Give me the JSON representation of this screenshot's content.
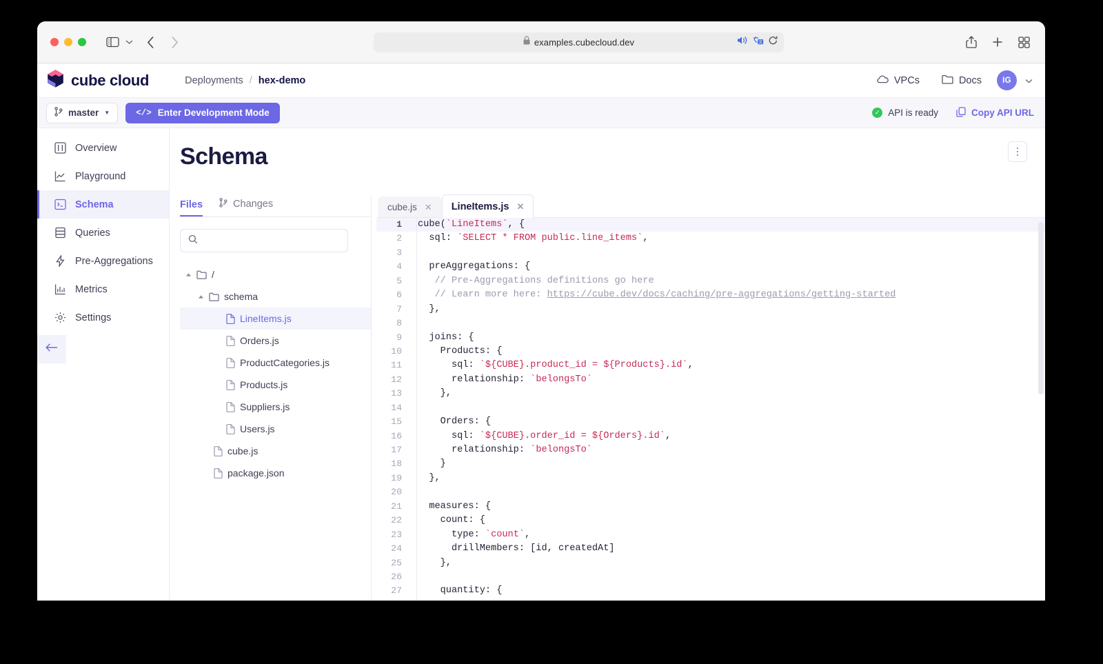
{
  "browser": {
    "url": "examples.cubecloud.dev",
    "lock_icon": "lock-icon",
    "traffic_lights": [
      "close",
      "minimize",
      "maximize"
    ],
    "icons": {
      "sidebar_toggle": "sidebar-toggle-icon",
      "sidebar_chevron": "chevron-down-icon",
      "back": "chevron-left-icon",
      "forward": "chevron-right-icon",
      "audio": "speaker-icon",
      "translate": "translate-icon",
      "reload": "reload-icon",
      "share": "share-icon",
      "new_tab": "plus-icon",
      "tab_overview": "tab-grid-icon"
    }
  },
  "topnav": {
    "logo_text": "cube cloud",
    "breadcrumb": {
      "root": "Deployments",
      "separator": "/",
      "current": "hex-demo"
    },
    "links": [
      {
        "label": "VPCs",
        "icon": "cloud-icon"
      },
      {
        "label": "Docs",
        "icon": "folder-icon"
      }
    ],
    "avatar_initials": "IG",
    "avatar_color": "#7a77eb"
  },
  "action_bar": {
    "branch": "master",
    "branch_icon": "git-branch-icon",
    "branch_chevron": "▼",
    "dev_mode_label": "Enter Development Mode",
    "dev_mode_glyph": "</>",
    "dev_mode_color": "#6c67e5",
    "api_status": "API is ready",
    "api_status_color": "#34c759",
    "copy_api_label": "Copy API URL",
    "copy_api_icon": "copy-icon"
  },
  "sidebar": {
    "items": [
      {
        "label": "Overview",
        "icon": "layout-icon",
        "active": false
      },
      {
        "label": "Playground",
        "icon": "chart-line-icon",
        "active": false
      },
      {
        "label": "Schema",
        "icon": "terminal-icon",
        "active": true
      },
      {
        "label": "Queries",
        "icon": "database-icon",
        "active": false
      },
      {
        "label": "Pre-Aggregations",
        "icon": "lightning-icon",
        "active": false
      },
      {
        "label": "Metrics",
        "icon": "bar-chart-icon",
        "active": false
      },
      {
        "label": "Settings",
        "icon": "gear-icon",
        "active": false
      }
    ],
    "collapse_icon": "arrow-left-icon"
  },
  "main": {
    "page_title": "Schema",
    "menu_icon": "kebab-vertical-icon"
  },
  "files_panel": {
    "tabs": [
      {
        "label": "Files",
        "icon": null,
        "active": true
      },
      {
        "label": "Changes",
        "icon": "git-branch-icon",
        "active": false
      }
    ],
    "search_placeholder": "",
    "search_value": "",
    "search_icon": "search-icon",
    "tree": [
      {
        "depth": 0,
        "type": "folder",
        "label": "/",
        "expanded": true,
        "selected": false
      },
      {
        "depth": 1,
        "type": "folder",
        "label": "schema",
        "expanded": true,
        "selected": false
      },
      {
        "depth": 2,
        "type": "file",
        "label": "LineItems.js",
        "selected": true
      },
      {
        "depth": 2,
        "type": "file",
        "label": "Orders.js",
        "selected": false
      },
      {
        "depth": 2,
        "type": "file",
        "label": "ProductCategories.js",
        "selected": false
      },
      {
        "depth": 2,
        "type": "file",
        "label": "Products.js",
        "selected": false
      },
      {
        "depth": 2,
        "type": "file",
        "label": "Suppliers.js",
        "selected": false
      },
      {
        "depth": 2,
        "type": "file",
        "label": "Users.js",
        "selected": false
      },
      {
        "depth": 1,
        "type": "file",
        "label": "cube.js",
        "selected": false
      },
      {
        "depth": 1,
        "type": "file",
        "label": "package.json",
        "selected": false
      }
    ]
  },
  "editor": {
    "tabs": [
      {
        "label": "cube.js",
        "active": false,
        "close_icon": "close-icon"
      },
      {
        "label": "LineItems.js",
        "active": true,
        "close_icon": "close-icon"
      }
    ],
    "current_line": 1,
    "lines": [
      {
        "n": 1,
        "tokens": [
          {
            "t": "plain",
            "v": "cube("
          },
          {
            "t": "tpl",
            "v": "`LineItems`"
          },
          {
            "t": "plain",
            "v": ", {"
          }
        ]
      },
      {
        "n": 2,
        "tokens": [
          {
            "t": "plain",
            "v": "  sql: "
          },
          {
            "t": "tpl",
            "v": "`SELECT * FROM public.line_items`"
          },
          {
            "t": "plain",
            "v": ","
          }
        ]
      },
      {
        "n": 3,
        "tokens": []
      },
      {
        "n": 4,
        "tokens": [
          {
            "t": "plain",
            "v": "  preAggregations: {"
          }
        ]
      },
      {
        "n": 5,
        "tokens": [
          {
            "t": "cmt",
            "v": "   // Pre-Aggregations definitions go here"
          }
        ]
      },
      {
        "n": 6,
        "tokens": [
          {
            "t": "cmt",
            "v": "   // Learn more here: "
          },
          {
            "t": "link",
            "v": "https://cube.dev/docs/caching/pre-aggregations/getting-started"
          }
        ]
      },
      {
        "n": 7,
        "tokens": [
          {
            "t": "plain",
            "v": "  },"
          }
        ]
      },
      {
        "n": 8,
        "tokens": []
      },
      {
        "n": 9,
        "tokens": [
          {
            "t": "plain",
            "v": "  joins: {"
          }
        ]
      },
      {
        "n": 10,
        "tokens": [
          {
            "t": "plain",
            "v": "    Products: {"
          }
        ]
      },
      {
        "n": 11,
        "tokens": [
          {
            "t": "plain",
            "v": "      sql: "
          },
          {
            "t": "tpl",
            "v": "`${CUBE}.product_id = ${Products}.id`"
          },
          {
            "t": "plain",
            "v": ","
          }
        ]
      },
      {
        "n": 12,
        "tokens": [
          {
            "t": "plain",
            "v": "      relationship: "
          },
          {
            "t": "tpl",
            "v": "`belongsTo`"
          }
        ]
      },
      {
        "n": 13,
        "tokens": [
          {
            "t": "plain",
            "v": "    },"
          }
        ]
      },
      {
        "n": 14,
        "tokens": []
      },
      {
        "n": 15,
        "tokens": [
          {
            "t": "plain",
            "v": "    Orders: {"
          }
        ]
      },
      {
        "n": 16,
        "tokens": [
          {
            "t": "plain",
            "v": "      sql: "
          },
          {
            "t": "tpl",
            "v": "`${CUBE}.order_id = ${Orders}.id`"
          },
          {
            "t": "plain",
            "v": ","
          }
        ]
      },
      {
        "n": 17,
        "tokens": [
          {
            "t": "plain",
            "v": "      relationship: "
          },
          {
            "t": "tpl",
            "v": "`belongsTo`"
          }
        ]
      },
      {
        "n": 18,
        "tokens": [
          {
            "t": "plain",
            "v": "    }"
          }
        ]
      },
      {
        "n": 19,
        "tokens": [
          {
            "t": "plain",
            "v": "  },"
          }
        ]
      },
      {
        "n": 20,
        "tokens": []
      },
      {
        "n": 21,
        "tokens": [
          {
            "t": "plain",
            "v": "  measures: {"
          }
        ]
      },
      {
        "n": 22,
        "tokens": [
          {
            "t": "plain",
            "v": "    count: {"
          }
        ]
      },
      {
        "n": 23,
        "tokens": [
          {
            "t": "plain",
            "v": "      type: "
          },
          {
            "t": "tpl",
            "v": "`count`"
          },
          {
            "t": "plain",
            "v": ","
          }
        ]
      },
      {
        "n": 24,
        "tokens": [
          {
            "t": "plain",
            "v": "      drillMembers: [id, createdAt]"
          }
        ]
      },
      {
        "n": 25,
        "tokens": [
          {
            "t": "plain",
            "v": "    },"
          }
        ]
      },
      {
        "n": 26,
        "tokens": []
      },
      {
        "n": 27,
        "tokens": [
          {
            "t": "plain",
            "v": "    quantity: {"
          }
        ]
      }
    ]
  }
}
